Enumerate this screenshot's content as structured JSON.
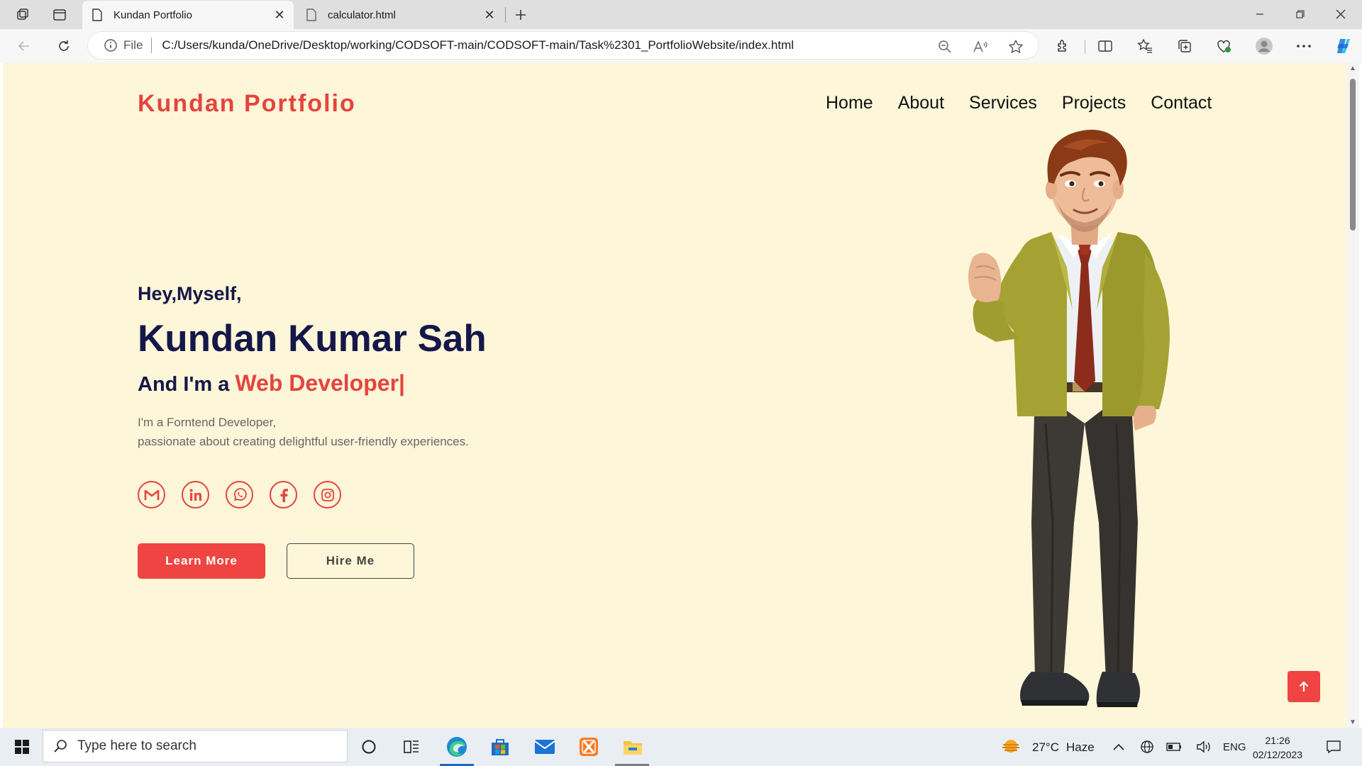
{
  "browser": {
    "tabs": [
      {
        "title": "Kundan Portfolio",
        "active": true
      },
      {
        "title": "calculator.html",
        "active": false
      }
    ],
    "address": {
      "scheme_label": "File",
      "url": "C:/Users/kunda/OneDrive/Desktop/working/CODSOFT-main/CODSOFT-main/Task%2301_PortfolioWebsite/index.html"
    }
  },
  "page": {
    "logo": "Kundan Portfolio",
    "nav": [
      "Home",
      "About",
      "Services",
      "Projects",
      "Contact"
    ],
    "hero": {
      "greeting": "Hey,Myself,",
      "name": "Kundan Kumar Sah",
      "role_prefix": "And I'm a",
      "role_accent": "Web Developer|",
      "desc_line1": "I'm a Forntend Developer,",
      "desc_line2": "passionate about creating delightful user-friendly experiences."
    },
    "socials": [
      "gmail-icon",
      "linkedin-icon",
      "whatsapp-icon",
      "facebook-icon",
      "instagram-icon"
    ],
    "buttons": {
      "learn_more": "Learn More",
      "hire_me": "Hire Me"
    },
    "colors": {
      "background": "#fdf6d8",
      "accent": "#e5443f",
      "primary_text": "#15174a"
    }
  },
  "taskbar": {
    "search_placeholder": "Type here to search",
    "weather": {
      "temp": "27°C",
      "condition": "Haze"
    },
    "language": "ENG",
    "time": "21:26",
    "date": "02/12/2023"
  }
}
